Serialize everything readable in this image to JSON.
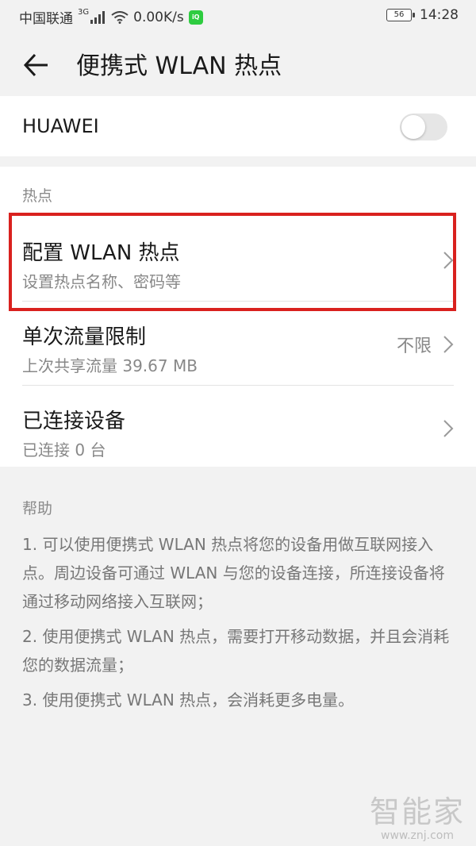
{
  "status_bar": {
    "carrier": "中国联通",
    "network": "3G",
    "speed": "0.00K/s",
    "app_icon": "iqiyi",
    "battery": "56",
    "time": "14:28"
  },
  "header": {
    "title": "便携式 WLAN 热点"
  },
  "hotspot_toggle": {
    "label": "HUAWEI",
    "state": false
  },
  "hotspot_section": {
    "header": "热点",
    "items": [
      {
        "title": "配置 WLAN 热点",
        "subtitle": "设置热点名称、密码等",
        "value": ""
      },
      {
        "title": "单次流量限制",
        "subtitle": "上次共享流量 39.67 MB",
        "value": "不限"
      },
      {
        "title": "已连接设备",
        "subtitle": "已连接 0 台",
        "value": ""
      }
    ]
  },
  "help": {
    "header": "帮助",
    "items": [
      "1. 可以使用便携式 WLAN 热点将您的设备用做互联网接入点。周边设备可通过 WLAN 与您的设备连接，所连接设备将通过移动网络接入互联网；",
      "2. 使用便携式 WLAN 热点，需要打开移动数据，并且会消耗您的数据流量；",
      "3. 使用便携式 WLAN 热点，会消耗更多电量。"
    ]
  },
  "watermark": {
    "text": "智能家",
    "url": "www.znj.com"
  },
  "colors": {
    "highlight": "#d9211e",
    "background": "#f2f2f2",
    "card": "#ffffff"
  }
}
